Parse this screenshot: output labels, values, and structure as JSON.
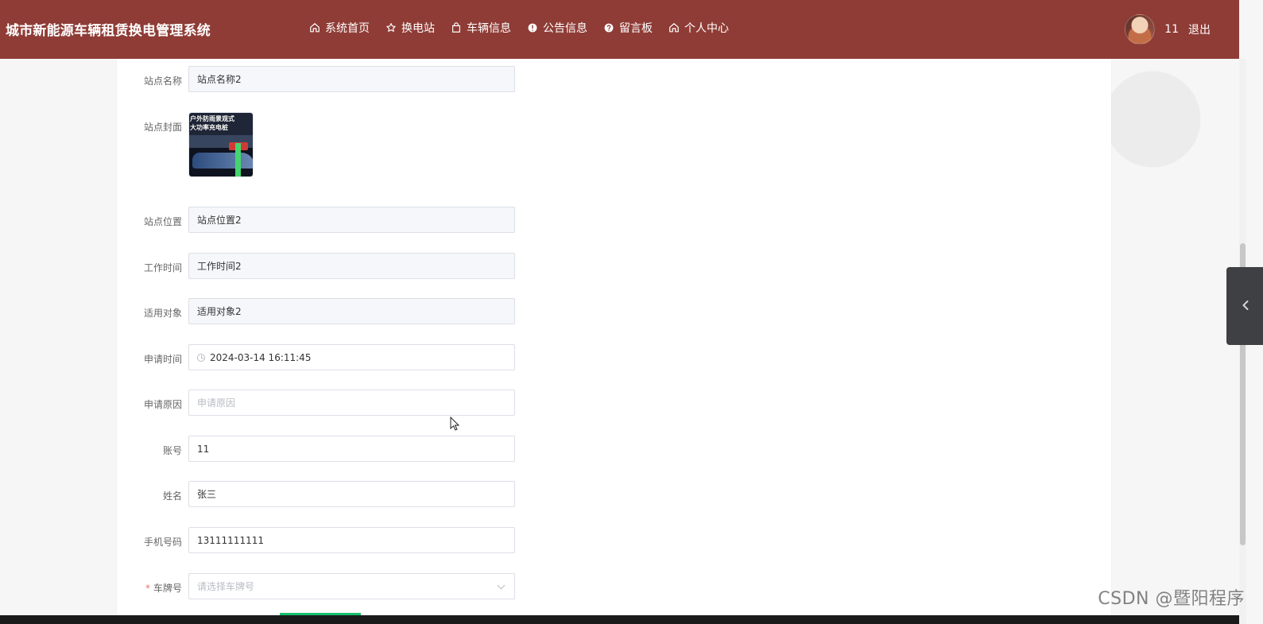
{
  "header": {
    "title": "城市新能源车辆租赁换电管理系统",
    "nav": [
      {
        "label": "系统首页",
        "icon": "home-icon"
      },
      {
        "label": "换电站",
        "icon": "star-icon"
      },
      {
        "label": "车辆信息",
        "icon": "bag-icon"
      },
      {
        "label": "公告信息",
        "icon": "alert-circle-icon"
      },
      {
        "label": "留言板",
        "icon": "help-circle-icon"
      },
      {
        "label": "个人中心",
        "icon": "home-icon"
      }
    ],
    "user": {
      "name": "11",
      "logout": "退出"
    }
  },
  "form": {
    "station_name_label": "站点名称",
    "station_name_value": "站点名称2",
    "station_cover_label": "站点封面",
    "station_cover_image_text": "户外防雨景观式\n大功率充电桩",
    "station_location_label": "站点位置",
    "station_location_value": "站点位置2",
    "work_time_label": "工作时间",
    "work_time_value": "工作时间2",
    "target_label": "适用对象",
    "target_value": "适用对象2",
    "apply_time_label": "申请时间",
    "apply_time_value": "2024-03-14 16:11:45",
    "apply_reason_label": "申请原因",
    "apply_reason_placeholder": "申请原因",
    "account_label": "账号",
    "account_value": "11",
    "name_label": "姓名",
    "name_value": "张三",
    "phone_label": "手机号码",
    "phone_value": "13111111111",
    "plate_label": "车牌号",
    "plate_placeholder": "请选择车牌号",
    "required_mark": "*"
  },
  "watermark": "CSDN @暨阳程序",
  "colors": {
    "header": "#8f3c36",
    "readonly_input": "#f5f7fa",
    "required": "#f56c6c"
  }
}
